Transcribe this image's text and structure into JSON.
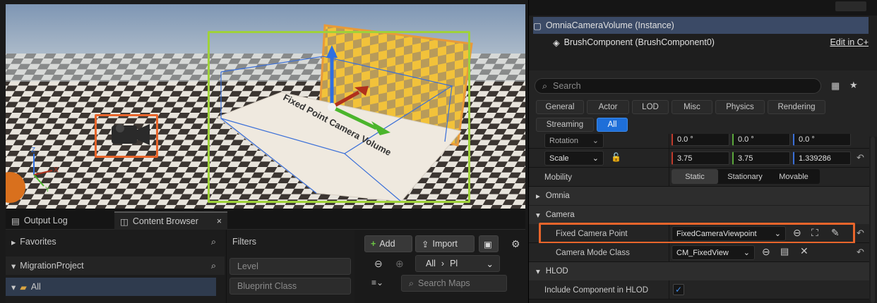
{
  "viewport": {
    "volume_label": "Fixed Point Camera Volume",
    "axis": {
      "x": "X",
      "y": "Y",
      "z": "Z"
    }
  },
  "bottom": {
    "tabs": [
      {
        "label": "Output Log",
        "icon": "output-log-icon"
      },
      {
        "label": "Content Browser",
        "icon": "content-browser-icon"
      }
    ],
    "close_glyph": "×",
    "tree": {
      "favorites": "Favorites",
      "project": "MigrationProject",
      "all": "All"
    },
    "filters": {
      "title": "Filters",
      "items": [
        "Level",
        "Blueprint Class"
      ]
    },
    "toolbar": {
      "add_label": "Add",
      "import_label": "Import",
      "path_root": "All",
      "path_next": "Pl",
      "search_placeholder": "Search Maps"
    }
  },
  "details": {
    "instance_title": "OmniaCameraVolume (Instance)",
    "component": "BrushComponent (BrushComponent0)",
    "edit_link": "Edit in C+",
    "search_placeholder": "Search",
    "categories": [
      "General",
      "Actor",
      "LOD",
      "Misc",
      "Physics",
      "Rendering",
      "Streaming",
      "All"
    ],
    "active_category": "All",
    "rotation": {
      "label": "Rotation",
      "x": "0.0 °",
      "y": "0.0 °",
      "z": "0.0 °"
    },
    "scale": {
      "label": "Scale",
      "x": "3.75",
      "y": "3.75",
      "z": "1.339286"
    },
    "mobility": {
      "label": "Mobility",
      "options": [
        "Static",
        "Stationary",
        "Movable"
      ],
      "selected": "Static"
    },
    "sections": {
      "omnia": "Omnia",
      "camera": "Camera",
      "hlod": "HLOD"
    },
    "fixed_camera_point": {
      "label": "Fixed Camera Point",
      "value": "FixedCameraViewpoint"
    },
    "camera_mode_class": {
      "label": "Camera Mode Class",
      "value": "CM_FixedView"
    },
    "include_hlod": {
      "label": "Include Component in HLOD",
      "checked": true
    }
  },
  "colors": {
    "highlight": "#e8652b",
    "volume_outline": "#9fd23a",
    "accent": "#1e6fd9"
  }
}
